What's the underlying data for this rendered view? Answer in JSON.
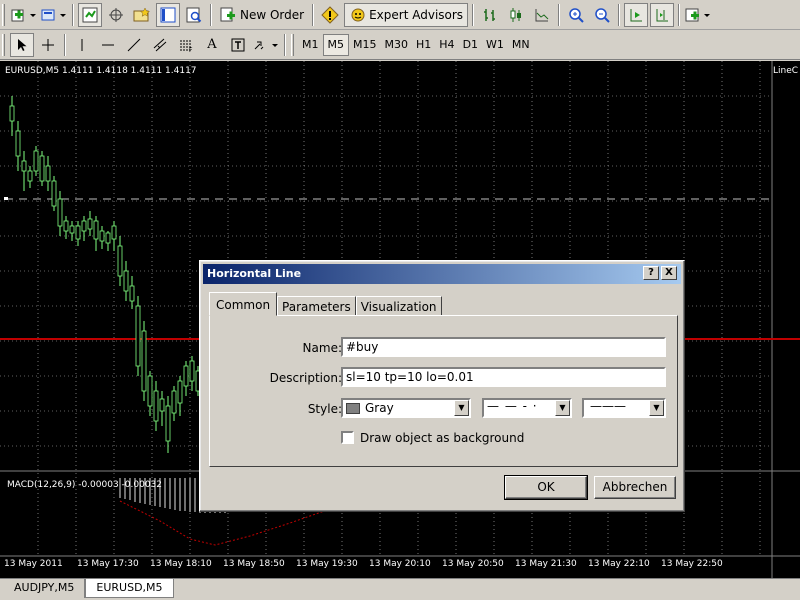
{
  "toolbar": {
    "new_order_label": "New Order",
    "expert_advisors_label": "Expert Advisors",
    "timeframes": [
      "M1",
      "M5",
      "M15",
      "M30",
      "H1",
      "H4",
      "D1",
      "W1",
      "MN"
    ],
    "active_timeframe": "M5",
    "text_tool_label": "A",
    "colors": {
      "green": "#1c9a1c",
      "yellow": "#f2c81a",
      "blue": "#1f4fc8"
    }
  },
  "chart": {
    "symbol_info": "EURUSD,M5  1.4111 1.4118 1.4111 1.4117",
    "right_label": "LineC",
    "macd_label": "MACD(12,26,9) -0.00003 -0.00032",
    "time_labels": [
      "13 May 2011",
      "13 May 17:30",
      "13 May 18:10",
      "13 May 18:50",
      "13 May 19:30",
      "13 May 20:10",
      "13 May 20:50",
      "13 May 21:30",
      "13 May 22:10",
      "13 May 22:50"
    ],
    "colors": {
      "background": "#000000",
      "grid": "#c0c0c0",
      "bull": "#80ff80",
      "line": "#c00000",
      "macd": "#c00000"
    }
  },
  "tabs": [
    "AUDJPY,M5",
    "EURUSD,M5"
  ],
  "dialog": {
    "title": "Horizontal Line",
    "help_label": "?",
    "close_label": "X",
    "tabs": [
      "Common",
      "Parameters",
      "Visualization"
    ],
    "name_label": "Name:",
    "name_value": "#buy",
    "description_label": "Description:",
    "description_value": "sl=10 tp=10 lo=0.01",
    "style_label": "Style:",
    "color_value": "Gray",
    "color_swatch": "#808080",
    "dash_style": "— — - ·",
    "line_width": "———",
    "checkbox_label": "Draw object as background",
    "ok_label": "OK",
    "cancel_label": "Abbrechen"
  }
}
